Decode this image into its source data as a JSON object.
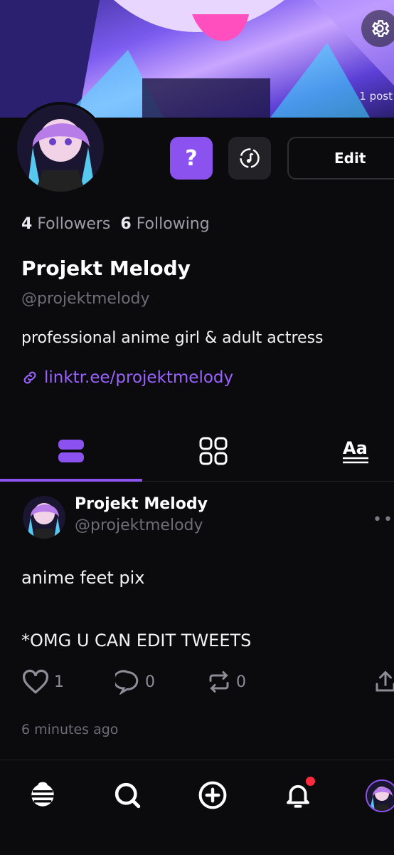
{
  "banner": {
    "post_count": "1 post"
  },
  "profile": {
    "question_label": "?",
    "edit_label": "Edit",
    "followers_count": "4",
    "followers_label": "Followers",
    "following_count": "6",
    "following_label": "Following",
    "display_name": "Projekt Melody",
    "handle": "@projektmelody",
    "bio": "professional anime girl & adult actress",
    "link": "linktr.ee/projektmelody"
  },
  "tabs": [
    {
      "name": "posts-tab",
      "icon": "list-icon",
      "active": true
    },
    {
      "name": "grid-tab",
      "icon": "grid-icon",
      "active": false
    },
    {
      "name": "text-tab",
      "icon": "text-format-icon",
      "active": false
    }
  ],
  "post": {
    "author_name": "Projekt Melody",
    "author_handle": "@projektmelody",
    "more": "••",
    "text_line1": "anime feet pix",
    "text_line2": "*OMG U CAN EDIT TWEETS",
    "likes": "1",
    "comments": "0",
    "reposts": "0",
    "time": "6 minutes ago"
  },
  "nav": {
    "items": [
      "home-icon",
      "search-icon",
      "create-icon",
      "bell-icon",
      "profile-avatar"
    ]
  },
  "colors": {
    "accent": "#8b52f0",
    "link": "#9a63ff",
    "background": "#0b0a0d",
    "notification": "#ff2a3d"
  }
}
